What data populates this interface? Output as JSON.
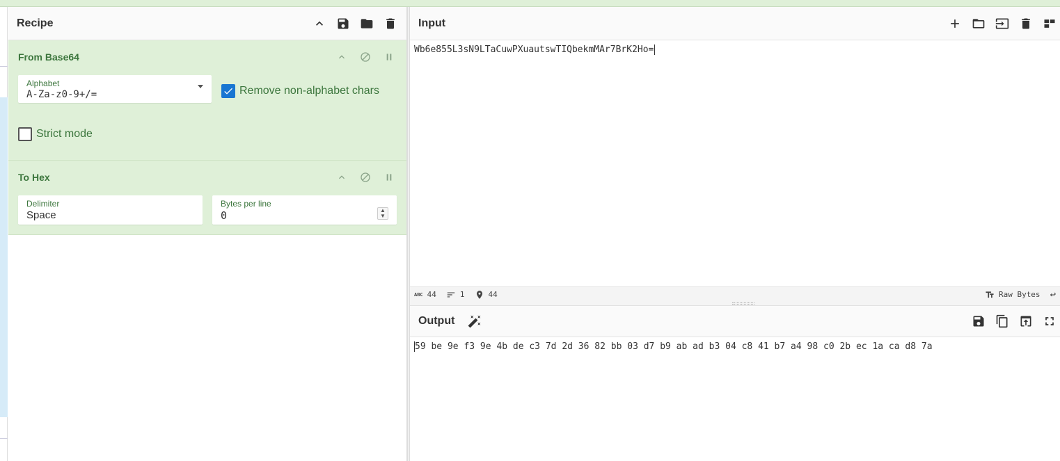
{
  "recipe": {
    "title": "Recipe",
    "operations": [
      {
        "name": "From Base64",
        "alphabet_label": "Alphabet",
        "alphabet_value": "A-Za-z0-9+/=",
        "remove_nonalpha_label": "Remove non-alphabet chars",
        "remove_nonalpha_checked": true,
        "strict_mode_label": "Strict mode",
        "strict_mode_checked": false
      },
      {
        "name": "To Hex",
        "delimiter_label": "Delimiter",
        "delimiter_value": "Space",
        "bytes_per_line_label": "Bytes per line",
        "bytes_per_line_value": "0"
      }
    ]
  },
  "input": {
    "title": "Input",
    "text": "Wb6e855L3sN9LTaCuwPXuautswTIQbekmMAr7BrK2Ho="
  },
  "status": {
    "chars": "44",
    "lines": "1",
    "position": "44",
    "encoding": "Raw Bytes"
  },
  "output": {
    "title": "Output",
    "text": "59 be 9e f3 9e 4b de c3 7d 2d 36 82 bb 03 d7 b9 ab ad b3 04 c8 41 b7 a4 98 c0 2b ec 1a ca d8 7a"
  },
  "colors": {
    "op_bg": "#dff0d8",
    "op_text": "#3c763d",
    "checkbox": "#1976d2"
  }
}
